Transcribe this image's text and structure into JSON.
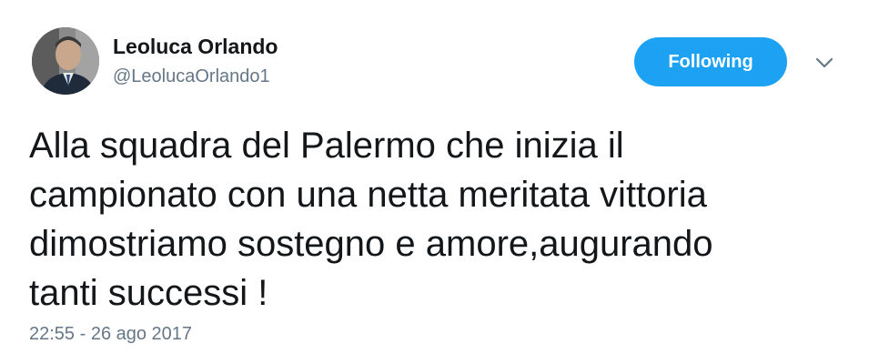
{
  "author": {
    "name": "Leoluca Orlando",
    "handle": "@LeolucaOrlando1",
    "avatar_icon": "profile-photo"
  },
  "follow_button": {
    "label": "Following",
    "color": "#1da1f2"
  },
  "menu": {
    "icon": "chevron-down-icon"
  },
  "tweet": {
    "lines": [
      "Alla squadra del Palermo che inizia il",
      "campionato con una netta meritata vittoria",
      "dimostriamo sostegno e amore,augurando",
      "tanti successi !"
    ]
  },
  "timestamp": "22:55 - 26 ago 2017",
  "colors": {
    "text": "#14171a",
    "secondary": "#657786"
  }
}
